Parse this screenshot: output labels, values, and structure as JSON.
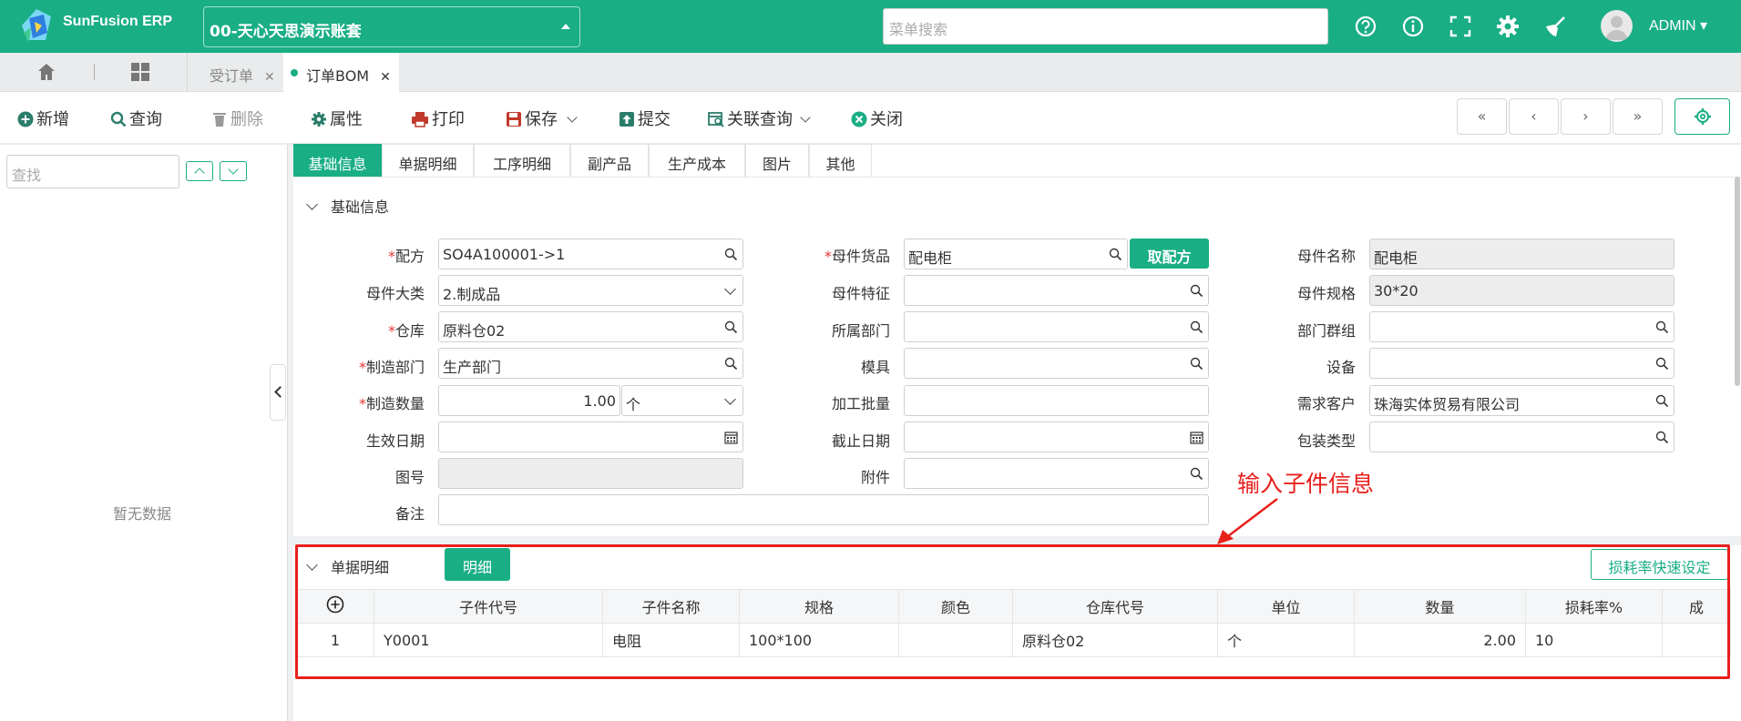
{
  "brand": {
    "name": "SunFusion ERP"
  },
  "account": {
    "label": "00-天心天思演示账套"
  },
  "search": {
    "placeholder": "菜单搜索"
  },
  "user": {
    "name": "ADMIN"
  },
  "tabs": {
    "items": [
      {
        "label": "受订单"
      },
      {
        "label": "订单BOM"
      }
    ]
  },
  "toolbar": {
    "new": "新增",
    "query": "查询",
    "delete": "删除",
    "properties": "属性",
    "print": "打印",
    "save": "保存",
    "submit": "提交",
    "related": "关联查询",
    "close": "关闭"
  },
  "left": {
    "find_placeholder": "查找",
    "empty": "暂无数据"
  },
  "form_tabs": [
    "基础信息",
    "单据明细",
    "工序明细",
    "副产品",
    "生产成本",
    "图片",
    "其他"
  ],
  "basic": {
    "section_title": "基础信息",
    "labels": {
      "recipe": "配方",
      "parent_category": "母件大类",
      "warehouse": "仓库",
      "mfg_dept": "制造部门",
      "mfg_qty": "制造数量",
      "effective_date": "生效日期",
      "drawing_no": "图号",
      "remark": "备注",
      "parent_item": "母件货品",
      "parent_feature": "母件特征",
      "dept": "所属部门",
      "mold": "模具",
      "batch": "加工批量",
      "end_date": "截止日期",
      "attachment": "附件",
      "parent_name": "母件名称",
      "parent_spec": "母件规格",
      "dept_group": "部门群组",
      "equipment": "设备",
      "customer": "需求客户",
      "package_type": "包装类型"
    },
    "values": {
      "recipe": "SO4A100001->1",
      "parent_category": "2.制成品",
      "warehouse": "原料仓02",
      "mfg_dept": "生产部门",
      "mfg_qty": "1.00",
      "unit": "个",
      "parent_item": "配电柜",
      "parent_name": "配电柜",
      "parent_spec": "30*20",
      "customer": "珠海实体贸易有限公司"
    },
    "get_recipe_button": "取配方"
  },
  "detail": {
    "section_title": "单据明细",
    "detail_button": "明细",
    "loss_rate_button": "损耗率快速设定",
    "columns": [
      "子件代号",
      "子件名称",
      "规格",
      "颜色",
      "仓库代号",
      "单位",
      "数量",
      "损耗率%",
      "成"
    ],
    "rows": [
      {
        "no": "1",
        "code": "Y0001",
        "name": "电阻",
        "spec": "100*100",
        "color": "",
        "wh": "原料仓02",
        "unit": "个",
        "qty": "2.00",
        "loss": "10",
        "extra": ""
      }
    ]
  },
  "annotation": {
    "text": "输入子件信息"
  },
  "colors": {
    "brand": "#1aae85",
    "annotation": "#e8201c"
  }
}
